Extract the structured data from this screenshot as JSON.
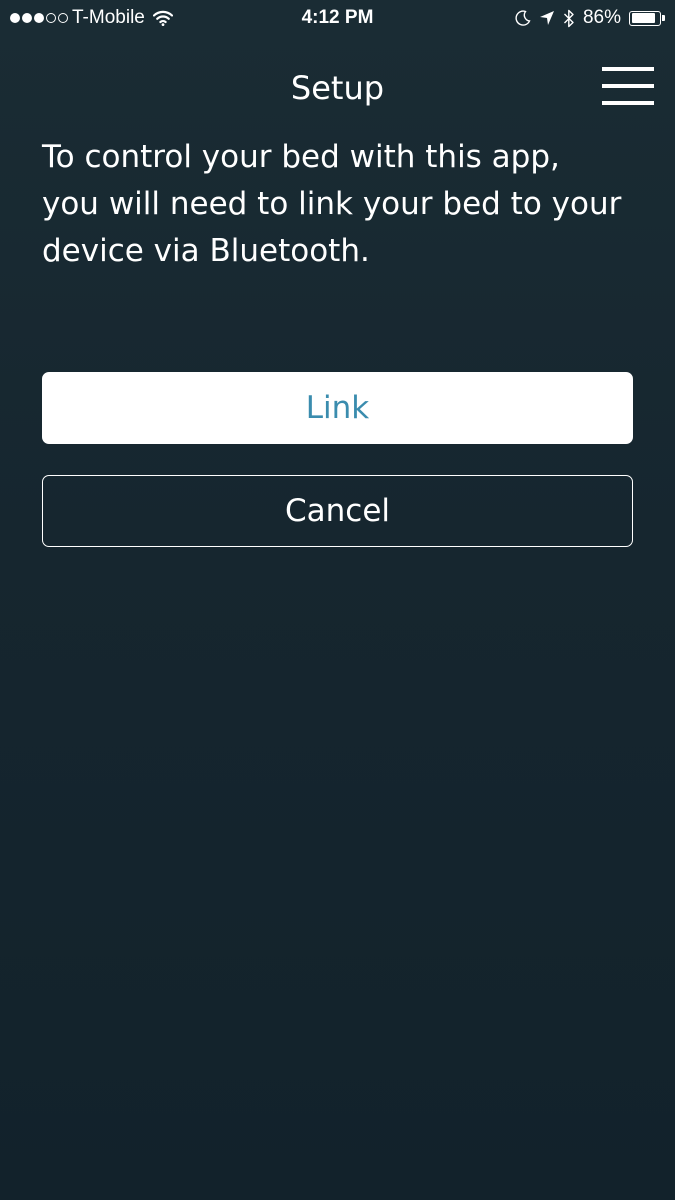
{
  "status_bar": {
    "signal_full_dots": 3,
    "signal_total_dots": 5,
    "carrier": "T-Mobile",
    "time": "4:12 PM",
    "battery_percent_text": "86%",
    "battery_level": 0.86,
    "icons": [
      "signal-dots",
      "wifi-icon",
      "moon-icon",
      "location-arrow-icon",
      "bluetooth-icon",
      "battery-icon"
    ]
  },
  "header": {
    "title": "Setup",
    "menu_icon": "hamburger-menu-icon"
  },
  "main": {
    "instructions": "To control your bed with this app, you will need to link your bed to your device via Bluetooth.",
    "link_label": "Link",
    "cancel_label": "Cancel"
  },
  "colors": {
    "background": "#1a2c34",
    "link_text": "#3a8cae",
    "text": "#ffffff"
  }
}
